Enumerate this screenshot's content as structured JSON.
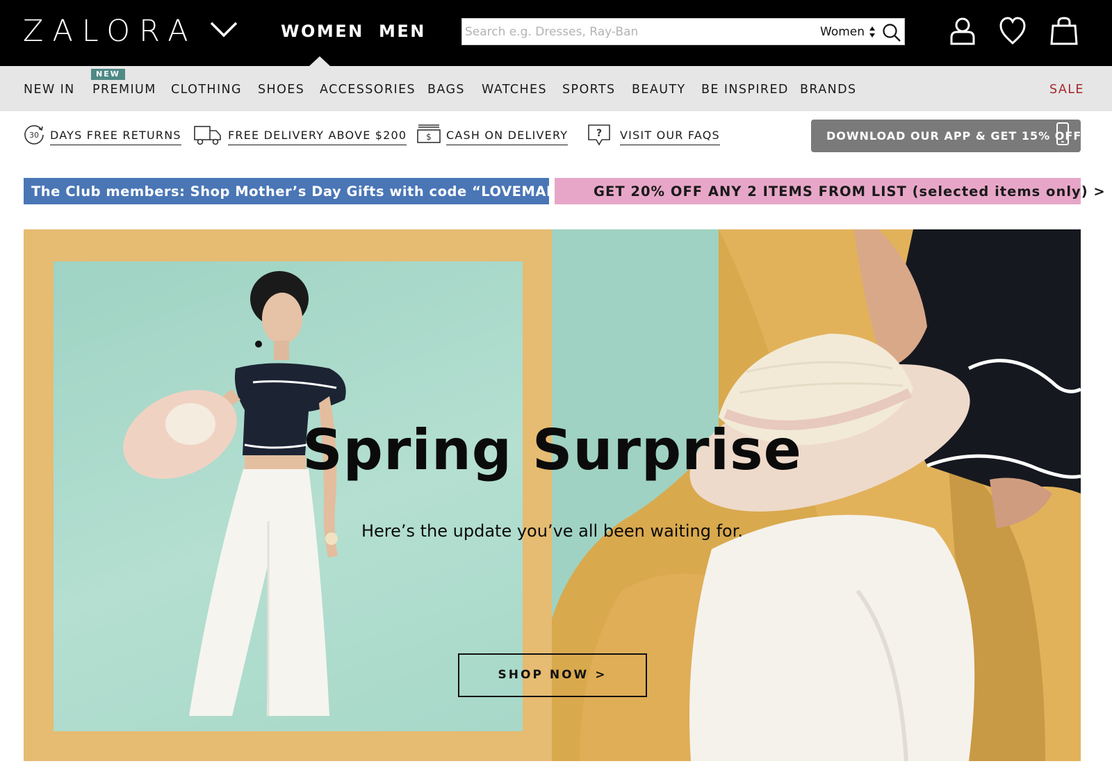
{
  "header": {
    "logo": "ZALORA",
    "tabs": [
      {
        "label": "WOMEN",
        "active": true
      },
      {
        "label": "MEN",
        "active": false
      }
    ],
    "search": {
      "placeholder": "Search e.g. Dresses, Ray-Ban",
      "value": "",
      "category": "Women"
    },
    "icons": [
      "account-icon",
      "wishlist-heart-icon",
      "shopping-bag-icon"
    ]
  },
  "category_nav": {
    "new_badge": "NEW",
    "items": [
      {
        "label": "NEW IN"
      },
      {
        "label": "PREMIUM"
      },
      {
        "label": "CLOTHING"
      },
      {
        "label": "SHOES"
      },
      {
        "label": "ACCESSORIES"
      },
      {
        "label": "BAGS"
      },
      {
        "label": "WATCHES"
      },
      {
        "label": "SPORTS"
      },
      {
        "label": "BEAUTY"
      },
      {
        "label": "BE INSPIRED"
      },
      {
        "label": "BRANDS"
      }
    ],
    "sale": "SALE",
    "sale_color": "#a3272d"
  },
  "services": {
    "items": [
      {
        "icon": "returns-30-icon",
        "icon_text": "30",
        "label": "DAYS FREE RETURNS"
      },
      {
        "icon": "delivery-truck-icon",
        "label": "FREE DELIVERY ABOVE $200"
      },
      {
        "icon": "cash-icon",
        "icon_text": "$",
        "label": "CASH ON DELIVERY"
      },
      {
        "icon": "faq-question-icon",
        "icon_text": "?",
        "label": "VISIT OUR FAQS"
      }
    ],
    "app_button": "DOWNLOAD OUR APP & GET 15% OFF"
  },
  "promos": {
    "club": "The Club members: Shop Mother’s Day Gifts with code “LOVEMAMA”",
    "club_color": "#4a76b6",
    "list": "GET 20% OFF ANY 2 ITEMS FROM LIST (selected items only) >",
    "list_color": "#e7a6c8"
  },
  "hero": {
    "title": "Spring Surprise",
    "subtitle": "Here’s the update you’ve all been waiting for.",
    "cta": "SHOP NOW >",
    "frame_color": "#e6bb72",
    "backdrop_color": "#a7d8c8"
  }
}
